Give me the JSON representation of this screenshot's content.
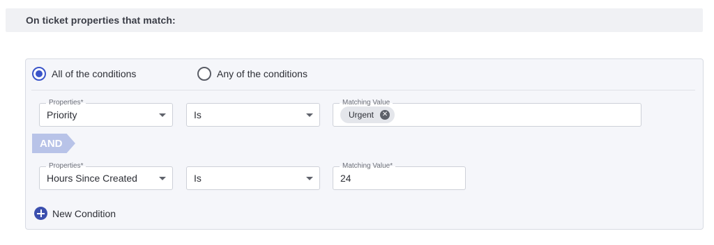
{
  "header": {
    "title": "On ticket properties that match:"
  },
  "match_mode": {
    "options": [
      {
        "label": "All of the conditions",
        "selected": true
      },
      {
        "label": "Any of the conditions",
        "selected": false
      }
    ]
  },
  "conditions": [
    {
      "property_label": "Properties*",
      "property_value": "Priority",
      "operator_value": "Is",
      "matching_label": "Matching Value",
      "matching_chips": [
        "Urgent"
      ]
    },
    {
      "property_label": "Properties*",
      "property_value": "Hours Since Created",
      "operator_value": "Is",
      "matching_label": "Matching Value*",
      "matching_value": "24"
    }
  ],
  "connector": {
    "label": "AND"
  },
  "new_condition": {
    "label": "New Condition"
  },
  "colors": {
    "accent": "#3b55c9",
    "and_tag": "#b8c3e8",
    "panel_bg": "#f5f6fa"
  }
}
